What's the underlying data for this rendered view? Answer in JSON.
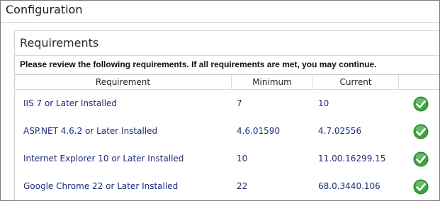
{
  "header": {
    "title": "Configuration"
  },
  "section": {
    "title": "Requirements",
    "instruction": "Please review the following requirements.  If all requirements are met, you may continue."
  },
  "table": {
    "columns": {
      "requirement": "Requirement",
      "minimum": "Minimum",
      "current": "Current",
      "status": ""
    },
    "rows": [
      {
        "requirement": "IIS 7 or Later Installed",
        "minimum": "7",
        "current": "10",
        "status_icon": "check-circle-icon",
        "status": "met"
      },
      {
        "requirement": "ASP.NET 4.6.2 or Later Installed",
        "minimum": "4.6.01590",
        "current": "4.7.02556",
        "status_icon": "check-circle-icon",
        "status": "met"
      },
      {
        "requirement": "Internet Explorer 10 or Later Installed",
        "minimum": "10",
        "current": "11.00.16299.15",
        "status_icon": "check-circle-icon",
        "status": "met"
      },
      {
        "requirement": "Google Chrome 22 or Later Installed",
        "minimum": "22",
        "current": "68.0.3440.106",
        "status_icon": "check-circle-icon",
        "status": "met"
      }
    ]
  },
  "colors": {
    "check_green": "#3aa53a",
    "text_blue": "#1c2c78"
  }
}
